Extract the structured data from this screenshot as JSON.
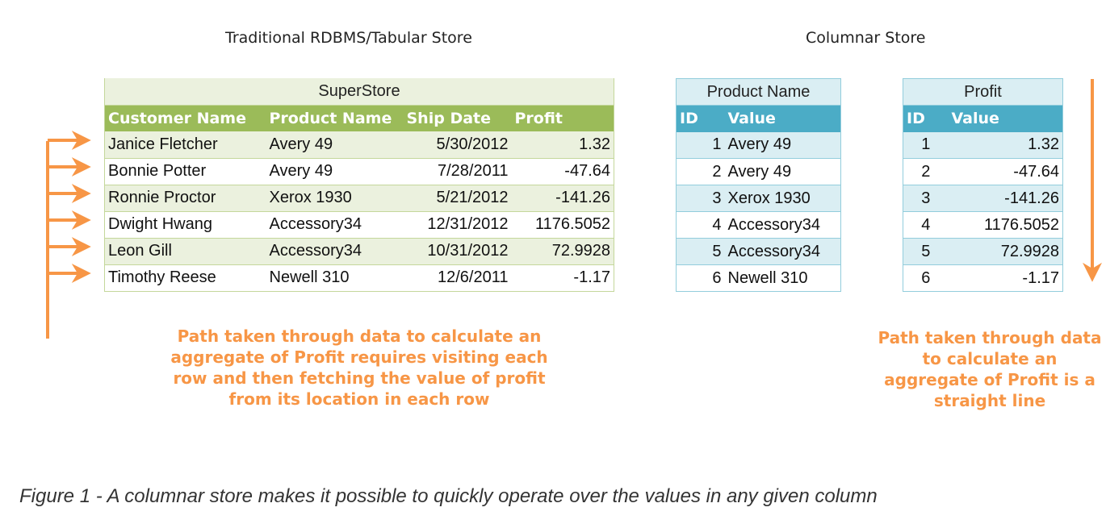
{
  "titles": {
    "traditional": "Traditional RDBMS/Tabular Store",
    "columnar": "Columnar Store"
  },
  "superstore": {
    "title": "SuperStore",
    "headers": [
      "Customer Name",
      "Product Name",
      "Ship Date",
      "Profit"
    ],
    "rows": [
      [
        "Janice Fletcher",
        "Avery 49",
        "5/30/2012",
        "1.32"
      ],
      [
        "Bonnie Potter",
        "Avery 49",
        "7/28/2011",
        "-47.64"
      ],
      [
        "Ronnie Proctor",
        "Xerox 1930",
        "5/21/2012",
        "-141.26"
      ],
      [
        "Dwight Hwang",
        "Accessory34",
        "12/31/2012",
        "1176.5052"
      ],
      [
        "Leon Gill",
        "Accessory34",
        "10/31/2012",
        "72.9928"
      ],
      [
        "Timothy Reese",
        "Newell 310",
        "12/6/2011",
        "-1.17"
      ]
    ]
  },
  "product_column": {
    "title": "Product Name",
    "headers": [
      "ID",
      "Value"
    ],
    "rows": [
      [
        "1",
        "Avery 49"
      ],
      [
        "2",
        "Avery 49"
      ],
      [
        "3",
        "Xerox 1930"
      ],
      [
        "4",
        "Accessory34"
      ],
      [
        "5",
        "Accessory34"
      ],
      [
        "6",
        "Newell 310"
      ]
    ]
  },
  "profit_column": {
    "title": "Profit",
    "headers": [
      "ID",
      "Value"
    ],
    "rows": [
      [
        "1",
        "1.32"
      ],
      [
        "2",
        "-47.64"
      ],
      [
        "3",
        "-141.26"
      ],
      [
        "4",
        "1176.5052"
      ],
      [
        "5",
        "72.9928"
      ],
      [
        "6",
        "-1.17"
      ]
    ]
  },
  "notes": {
    "left": "Path taken through data to calculate an aggregate of Profit requires visiting each row and then fetching the value of profit from its location in each row",
    "right": "Path taken through data to calculate an aggregate of Profit is a straight line"
  },
  "caption": "Figure 1 - A columnar store makes it possible to quickly operate over the values in any given column",
  "colors": {
    "accent_orange": "#f79646",
    "green_header": "#9bbb59",
    "green_band": "#ebf1de",
    "blue_header": "#4bacc6",
    "blue_band": "#daeef3"
  }
}
